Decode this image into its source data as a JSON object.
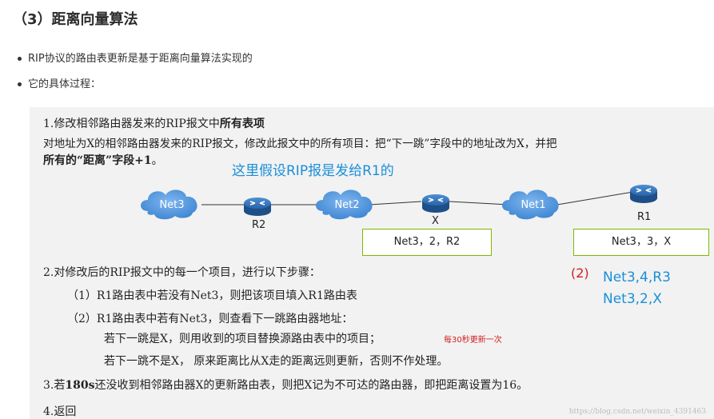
{
  "heading": "（3）距离向量算法",
  "bullets": [
    "RIP协议的路由表更新是基于距离向量算法实现的",
    "它的具体过程："
  ],
  "step1": {
    "title_a": "1.修改相邻路由器发来的RIP报文中",
    "title_b": "所有表项",
    "line2": "对地址为X的相邻路由器发来的RIP报文，修改此报文中的所有项目：把“下一跳”字段中的地址改为X，并把",
    "line3_a": "所有的",
    "line3_b": "“距离”",
    "line3_c": "字段+1",
    "line3_d": "。"
  },
  "annotation_r1": "这里假设RIP报是发给R1的",
  "diagram": {
    "clouds": [
      "Net3",
      "Net2",
      "Net1"
    ],
    "routers": [
      "R2",
      "X",
      "R1"
    ],
    "box_x": "Net3，2，R2",
    "box_r1": "Net3，3，X"
  },
  "note2": {
    "label": "(2)",
    "lines": [
      "Net3,4,R3",
      "Net3,2,X"
    ]
  },
  "step2": {
    "title": "2.对修改后的RIP报文中的每一个项目，进行以下步骤：",
    "sub1": "（1）R1路由表中若没有Net3，则把该项目填入R1路由表",
    "sub2": "（2）R1路由表中若有Net3，则查看下一跳路由器地址：",
    "sub2a": "若下一跳是X，则用收到的项目替换源路由表中的项目；",
    "sub2a_note": "每30秒更新一次",
    "sub2b": "若下一跳不是X，  原来距离比从X走的距离远则更新，否则不作处理。"
  },
  "step3": {
    "a": "3.若",
    "b": "180s",
    "c": "还没收到相邻路由器X的更新路由表，则把X记为不可达的路由器，即把距离设置为16。"
  },
  "step4": "4.返回",
  "watermark": "https://blog.csdn.net/weixin_4391463",
  "colors": {
    "panel": "#f2f2f2",
    "annotation_blue": "#1a8fd8",
    "annotation_red": "#d21d1d",
    "box_border": "#7fb800",
    "cloud": "#4a90d9",
    "router": "#2f6fb4"
  }
}
